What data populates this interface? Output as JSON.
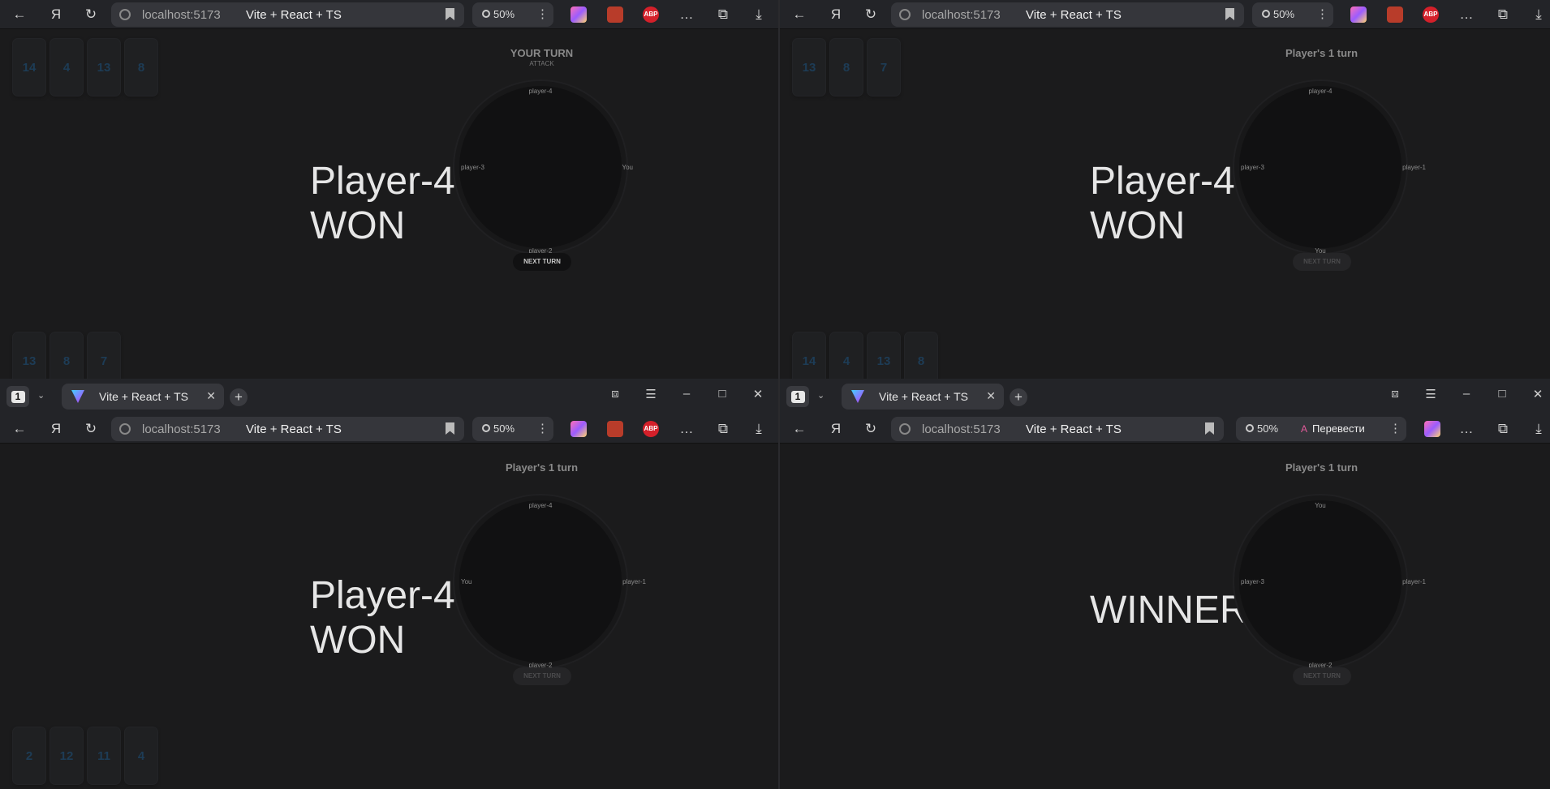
{
  "browser": {
    "host": "localhost:5173",
    "page_title": "Vite + React + TS",
    "tab_label": "Vite + React + TS",
    "tab_count": "1",
    "zoom": "50%",
    "translate_label": "Перевести",
    "abp_label": "ABP"
  },
  "panels": [
    {
      "turn": "YOUR TURN",
      "phase": "ATTACK",
      "banner_line1": "Player-4",
      "banner_line2": "WON",
      "seats": {
        "north": "player-4",
        "west": "player-3",
        "east": "You",
        "south": "player-2"
      },
      "next_turn": "NEXT TURN",
      "top_cards": [
        "14",
        "4",
        "13",
        "8"
      ],
      "bottom_cards": [
        "13",
        "8",
        "7"
      ]
    },
    {
      "turn": "Player's 1 turn",
      "banner_line1": "Player-4",
      "banner_line2": "WON",
      "seats": {
        "north": "player-4",
        "west": "player-3",
        "east": "player-1",
        "south": "You"
      },
      "next_turn": "NEXT TURN",
      "top_cards": [
        "13",
        "8",
        "7"
      ],
      "bottom_cards": [
        "14",
        "4",
        "13",
        "8"
      ]
    },
    {
      "turn": "Player's 1 turn",
      "banner_line1": "Player-4",
      "banner_line2": "WON",
      "seats": {
        "north": "player-4",
        "west": "You",
        "east": "player-1",
        "south": "player-2"
      },
      "next_turn": "NEXT TURN",
      "bottom_cards": [
        "2",
        "12",
        "11",
        "4"
      ]
    },
    {
      "turn": "Player's 1 turn",
      "banner_line1": "WINNER",
      "seats": {
        "north": "You",
        "west": "player-3",
        "east": "player-1",
        "south": "player-2"
      },
      "next_turn": "NEXT TURN"
    }
  ]
}
